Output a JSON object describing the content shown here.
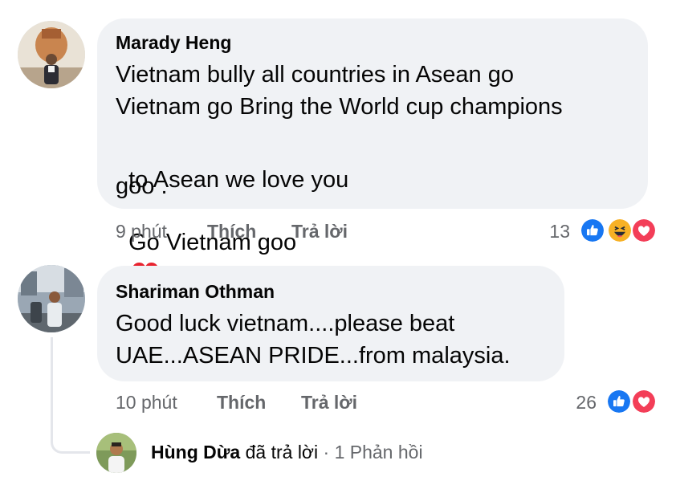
{
  "comments": [
    {
      "author": "Marady Heng",
      "text_line1": "Vietnam bully all countries in Asean go",
      "text_line2": "Vietnam go Bring the World cup champions",
      "text_line3a": "to Asean we love you",
      "text_line3b": "Go Vietnam goo",
      "text_line4": "goo .",
      "inline_emoji": "red-heart",
      "time": "9 phút",
      "like_label": "Thích",
      "reply_label": "Trả lời",
      "reaction_count": "13",
      "reactions": [
        "like",
        "haha",
        "love"
      ]
    },
    {
      "author": "Shariman Othman",
      "text_line1": "Good luck vietnam....please beat",
      "text_line2": "UAE...ASEAN PRIDE...from malaysia.",
      "time": "10 phút",
      "like_label": "Thích",
      "reply_label": "Trả lời",
      "reaction_count": "26",
      "reactions": [
        "like",
        "love"
      ]
    }
  ],
  "reply_summary": {
    "name": "Hùng Dừa",
    "action": "đã trả lời",
    "separator": "·",
    "count_text": "1 Phản hồi"
  },
  "colors": {
    "bubble": "#f0f2f5",
    "meta_text": "#65676b",
    "like_blue": "#1877f2",
    "love_red": "#f33e58",
    "haha_yellow": "#f7b125"
  }
}
